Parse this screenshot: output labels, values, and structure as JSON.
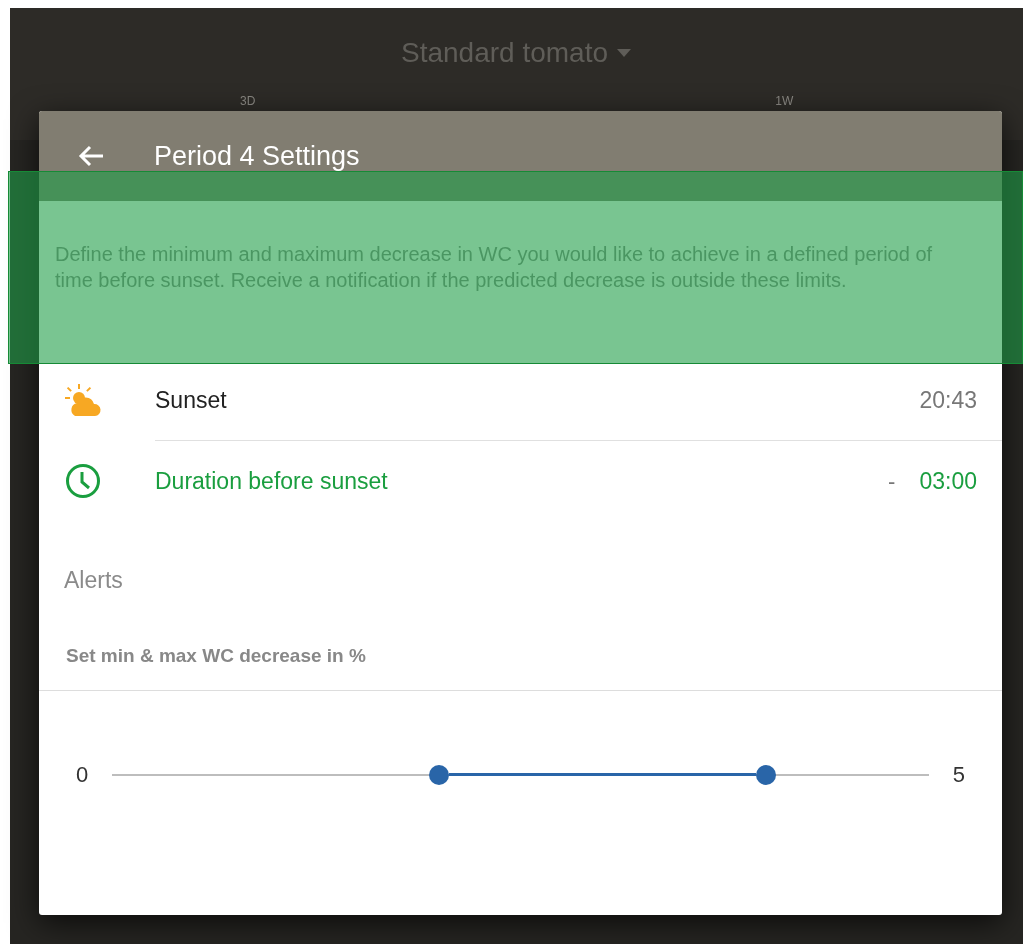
{
  "app_bar": {
    "title": "Standard tomato",
    "range_labels": [
      "3D",
      "1W"
    ]
  },
  "dialog": {
    "title": "Period 4 Settings",
    "description": "Define the minimum and maximum decrease in WC you would like to achieve in a defined period of time before sunset. Receive a notification if the predicted decrease is outside these limits.",
    "rows": [
      {
        "kind": "sunset",
        "label": "Sunset",
        "value": "20:43",
        "prefix": null,
        "active": false
      },
      {
        "kind": "duration",
        "label": "Duration before sunset",
        "value": "03:00",
        "prefix": "-",
        "active": true
      }
    ],
    "alerts_heading": "Alerts",
    "slider_label": "Set min & max WC decrease in %",
    "slider": {
      "min_label": "0",
      "max_label": "5",
      "low": {
        "level": 0.4
      },
      "high": {
        "level": 0.8
      }
    }
  },
  "highlight": {
    "shown": true
  }
}
